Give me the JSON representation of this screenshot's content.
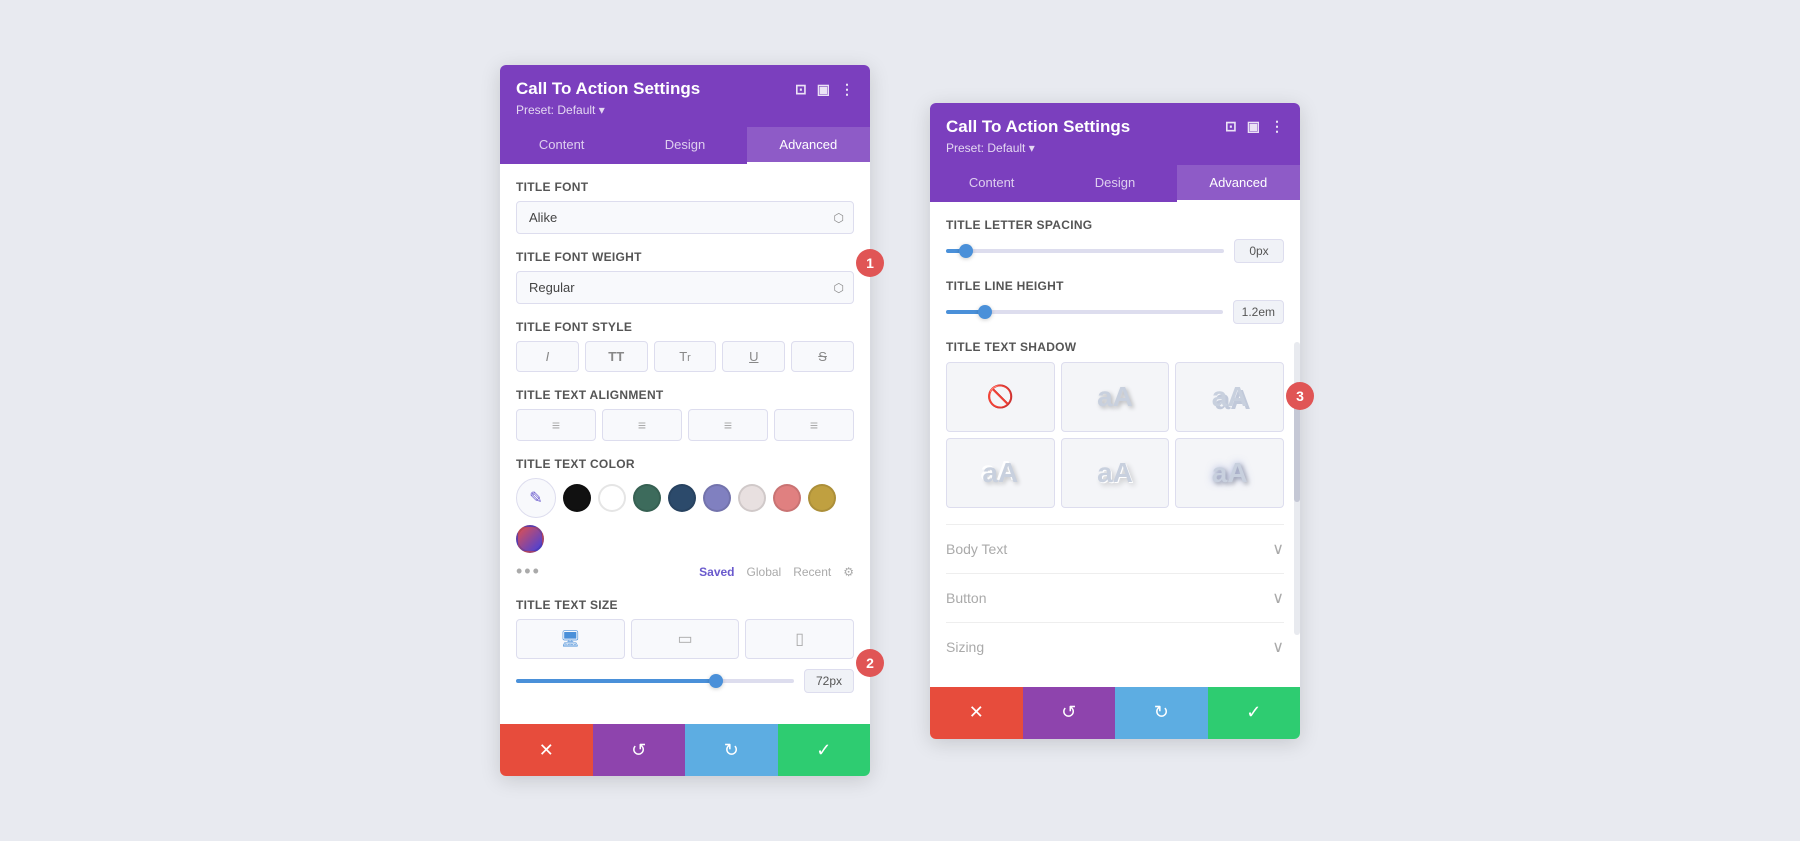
{
  "left_panel": {
    "title": "Call To Action Settings",
    "preset": "Preset: Default",
    "tabs": [
      "Content",
      "Design",
      "Advanced"
    ],
    "active_tab": "Advanced",
    "badge1": "1",
    "badge2": "2",
    "fields": {
      "title_font": {
        "label": "Title Font",
        "value": "Alike"
      },
      "title_font_weight": {
        "label": "Title Font Weight",
        "value": "Regular"
      },
      "title_font_style": {
        "label": "Title Font Style",
        "buttons": [
          "I",
          "TT",
          "Tr",
          "U",
          "S"
        ]
      },
      "title_text_alignment": {
        "label": "Title Text Alignment"
      },
      "title_text_color": {
        "label": "Title Text Color",
        "swatches": [
          "#111111",
          "#ffffff",
          "#3d6b5c",
          "#2c4a6b",
          "#8080c0",
          "#e8e0e0",
          "#e08080",
          "#c0a040",
          "#e05050"
        ],
        "footer": {
          "saved": "Saved",
          "global": "Global",
          "recent": "Recent"
        }
      },
      "title_text_size": {
        "label": "Title Text Size",
        "value": "72px",
        "slider_pct": "73"
      }
    },
    "footer": {
      "cancel": "✕",
      "undo": "↺",
      "redo": "↻",
      "save": "✓"
    }
  },
  "right_panel": {
    "title": "Call To Action Settings",
    "preset": "Preset: Default",
    "tabs": [
      "Content",
      "Design",
      "Advanced"
    ],
    "active_tab": "Advanced",
    "badge3": "3",
    "fields": {
      "title_letter_spacing": {
        "label": "Title Letter Spacing",
        "value": "0px",
        "slider_pct": "5"
      },
      "title_line_height": {
        "label": "Title Line Height",
        "value": "1.2em",
        "slider_pct": "12"
      },
      "title_text_shadow": {
        "label": "Title Text Shadow"
      },
      "body_text": {
        "label": "Body Text"
      },
      "button": {
        "label": "Button"
      },
      "sizing": {
        "label": "Sizing"
      }
    },
    "footer": {
      "cancel": "✕",
      "undo": "↺",
      "redo": "↻",
      "save": "✓"
    }
  }
}
